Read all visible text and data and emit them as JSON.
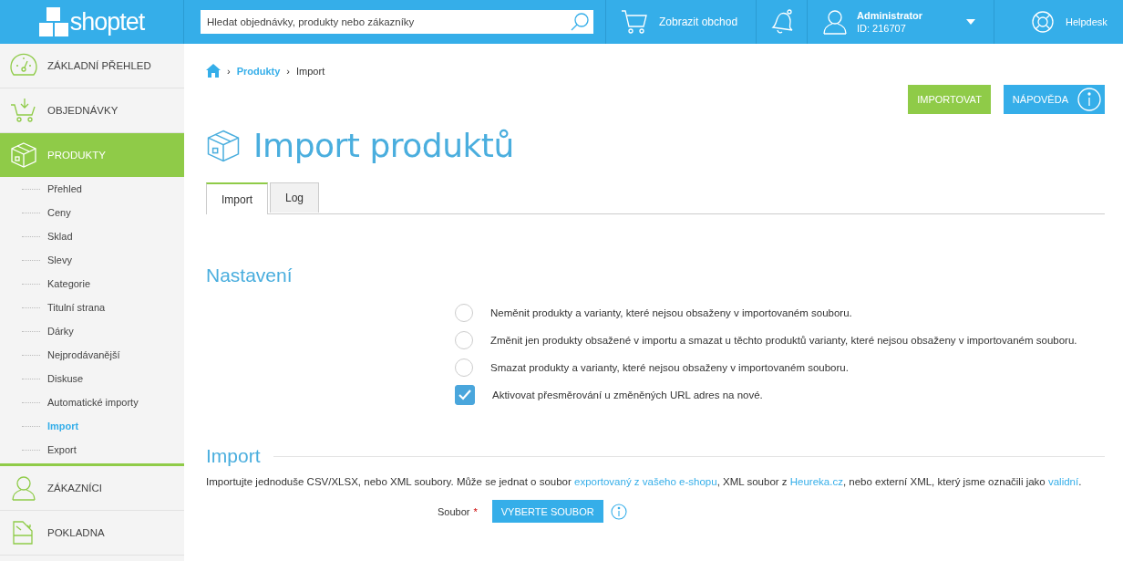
{
  "header": {
    "logo": "shoptet",
    "search": {
      "placeholder": "Hledat objednávky, produkty nebo zákazníky"
    },
    "shop_link": "Zobrazit obchod",
    "user": {
      "name": "Administrator",
      "id": "ID: 216707"
    },
    "helpdesk": "Helpdesk"
  },
  "sidebar": {
    "items": [
      {
        "label": "ZÁKLADNÍ PŘEHLED",
        "selected": false
      },
      {
        "label": "OBJEDNÁVKY",
        "selected": false
      },
      {
        "label": "PRODUKTY",
        "selected": true,
        "children": [
          {
            "label": "Přehled",
            "selected": false
          },
          {
            "label": "Ceny",
            "selected": false
          },
          {
            "label": "Sklad",
            "selected": false
          },
          {
            "label": "Slevy",
            "selected": false
          },
          {
            "label": "Kategorie",
            "selected": false
          },
          {
            "label": "Titulní strana",
            "selected": false
          },
          {
            "label": "Dárky",
            "selected": false
          },
          {
            "label": "Nejprodávanější",
            "selected": false
          },
          {
            "label": "Diskuse",
            "selected": false
          },
          {
            "label": "Automatické importy",
            "selected": false
          },
          {
            "label": "Import",
            "selected": true
          },
          {
            "label": "Export",
            "selected": false
          }
        ]
      },
      {
        "label": "ZÁKAZNÍCI",
        "selected": false
      },
      {
        "label": "POKLADNA",
        "selected": false
      }
    ]
  },
  "breadcrumb": [
    {
      "separator": "›",
      "label": "Produkty",
      "kind": "link"
    },
    {
      "separator": "›",
      "label": "Import",
      "kind": "current"
    }
  ],
  "actions": {
    "import_button": "IMPORTOVAT",
    "help_button": "NÁPOVĚDA"
  },
  "title": "Import produktů",
  "tabs": [
    {
      "label": "Import",
      "selected": true
    },
    {
      "label": "Log",
      "selected": false
    }
  ],
  "settings": {
    "heading": "Nastavení",
    "options": [
      {
        "kind": "radio",
        "label": "Neměnit produkty a varianty, které nejsou obsaženy v importovaném souboru.",
        "checked": false
      },
      {
        "kind": "radio",
        "label": "Změnit jen produkty obsažené v importu a smazat u těchto produktů varianty, které nejsou obsaženy v importovaném souboru.",
        "checked": false
      },
      {
        "kind": "radio",
        "label": "Smazat produkty a varianty, které nejsou obsaženy v importovaném souboru.",
        "checked": false
      },
      {
        "kind": "checkbox",
        "label": "Aktivovat přesměrování u změněných URL adres na nové.",
        "checked": true
      }
    ]
  },
  "import": {
    "heading": "Import",
    "description": [
      {
        "kind": "text",
        "text": "Importujte jednoduše CSV/XLSX, nebo XML soubory. Může se jednat o soubor "
      },
      {
        "kind": "link",
        "text": "exportovaný z vašeho e-shopu"
      },
      {
        "kind": "text",
        "text": ", XML soubor z "
      },
      {
        "kind": "link",
        "text": "Heureka.cz"
      },
      {
        "kind": "text",
        "text": ", nebo externí XML, který jsme označili jako "
      },
      {
        "kind": "link",
        "text": "validní"
      },
      {
        "kind": "text",
        "text": "."
      }
    ],
    "file_label": "Soubor",
    "required_mark": "*",
    "file_button": "VYBERTE SOUBOR"
  }
}
